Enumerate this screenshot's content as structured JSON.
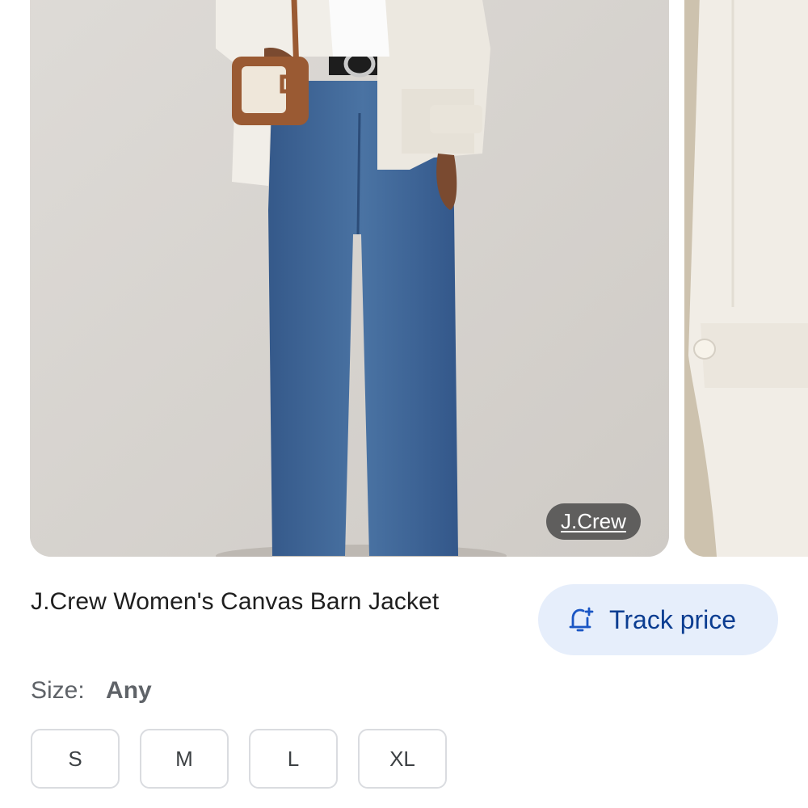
{
  "carousel": {
    "source_badge": "J.Crew",
    "colors": {
      "photo_background": "#d8d5d1",
      "denim": "#3f6897",
      "jacket": "#efebe4",
      "bag_leather": "#9a5a33"
    }
  },
  "product": {
    "title": "J.Crew Women's Canvas Barn Jacket",
    "track_price_label": "Track price",
    "track_price_icon": "bell-plus-icon"
  },
  "size": {
    "label": "Size:",
    "value": "Any",
    "options": [
      "S",
      "M",
      "L",
      "XL"
    ]
  },
  "colors": {
    "accent_text": "#0b3d91",
    "accent_bg": "#e6eefb",
    "chip_border": "#dadce0"
  }
}
